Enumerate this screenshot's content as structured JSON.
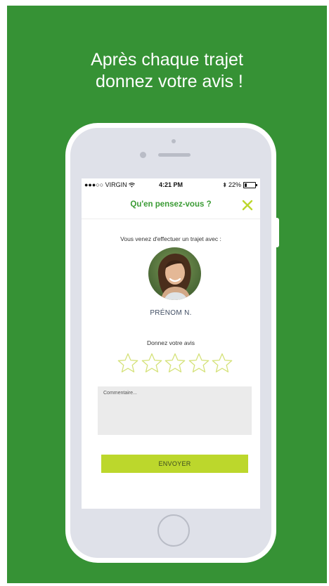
{
  "headline": {
    "line1": "Après chaque trajet",
    "line2": " donnez votre avis !"
  },
  "statusbar": {
    "carrier": "●●●○○ VIRGIN",
    "time": "4:21 PM",
    "battery": "22%",
    "battery_level": 0.22
  },
  "nav": {
    "title": "Qu'en pensez-vous ?"
  },
  "main": {
    "intro": "Vous venez d'effectuer un trajet avec :",
    "driver_name": "PRÉNOM N.",
    "rating_label": "Donnez votre avis",
    "rating_value": 0,
    "rating_max": 5,
    "comment_placeholder": "Commentaire...",
    "comment_value": "",
    "submit_label": "ENVOYER"
  },
  "colors": {
    "background": "#369235",
    "accent_green": "#3a9b34",
    "lime": "#bcd72c",
    "star_outline": "#d5e27a"
  },
  "icons": {
    "close": "close-icon",
    "wifi": "wifi-icon",
    "bluetooth": "bluetooth-icon",
    "battery": "battery-icon",
    "star": "star-outline-icon"
  }
}
